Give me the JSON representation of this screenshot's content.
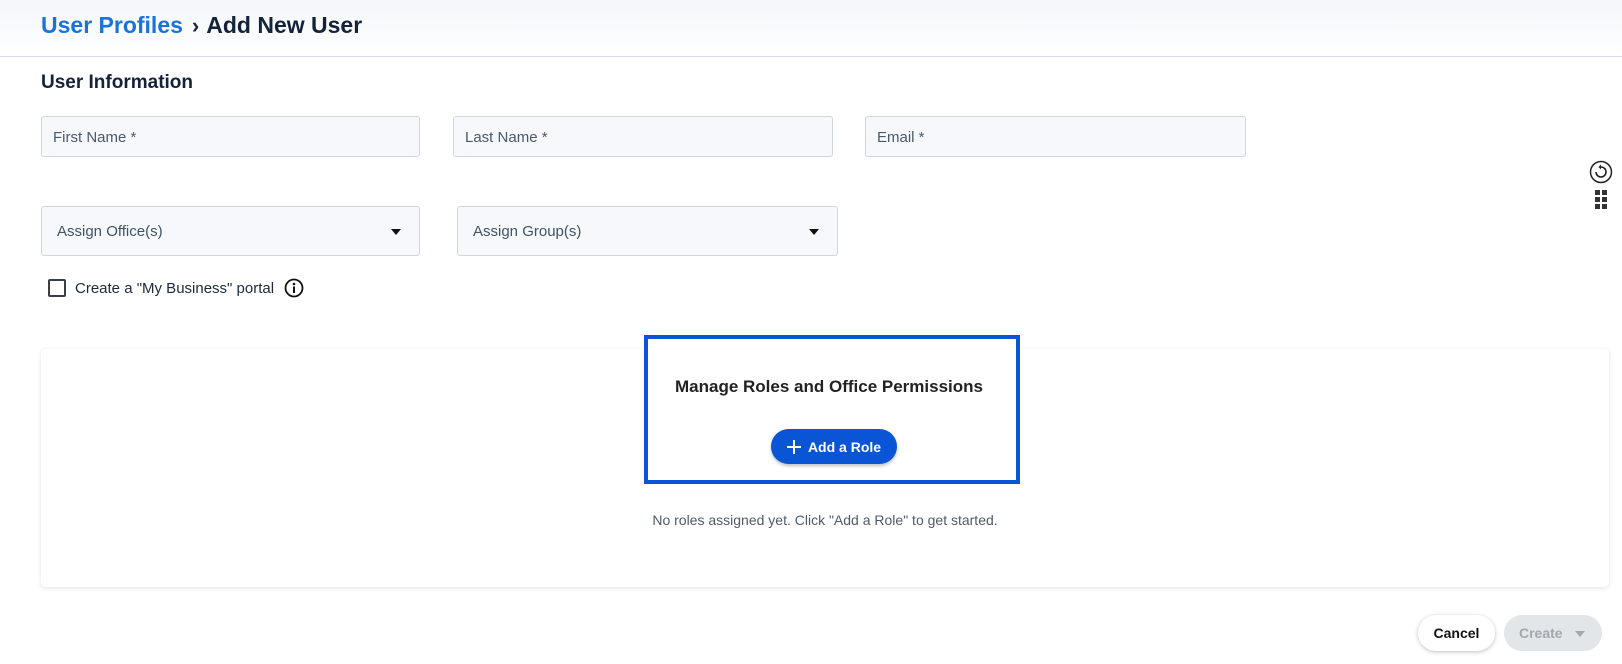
{
  "breadcrumb": {
    "parent": "User Profiles",
    "separator": "›",
    "current": "Add New User"
  },
  "section": {
    "title": "User Information"
  },
  "fields": {
    "first_name": {
      "placeholder": "First Name *",
      "value": ""
    },
    "last_name": {
      "placeholder": "Last Name *",
      "value": ""
    },
    "email": {
      "placeholder": "Email *",
      "value": ""
    }
  },
  "selects": {
    "offices": {
      "label": "Assign Office(s)"
    },
    "groups": {
      "label": "Assign Group(s)"
    }
  },
  "portal": {
    "label": "Create a \"My Business\" portal",
    "checked": false
  },
  "roles": {
    "title": "Manage Roles and Office Permissions",
    "add_label": "Add a Role",
    "empty_message": "No roles assigned yet. Click \"Add a Role\" to get started."
  },
  "actions": {
    "cancel": "Cancel",
    "create": "Create"
  },
  "colors": {
    "accent": "#0a54d6",
    "link": "#1a73d9",
    "disabled": "#e3e6e9"
  },
  "icons": [
    "info-icon",
    "plus-icon",
    "refresh-icon",
    "grid-icon",
    "chevron-down-icon"
  ]
}
